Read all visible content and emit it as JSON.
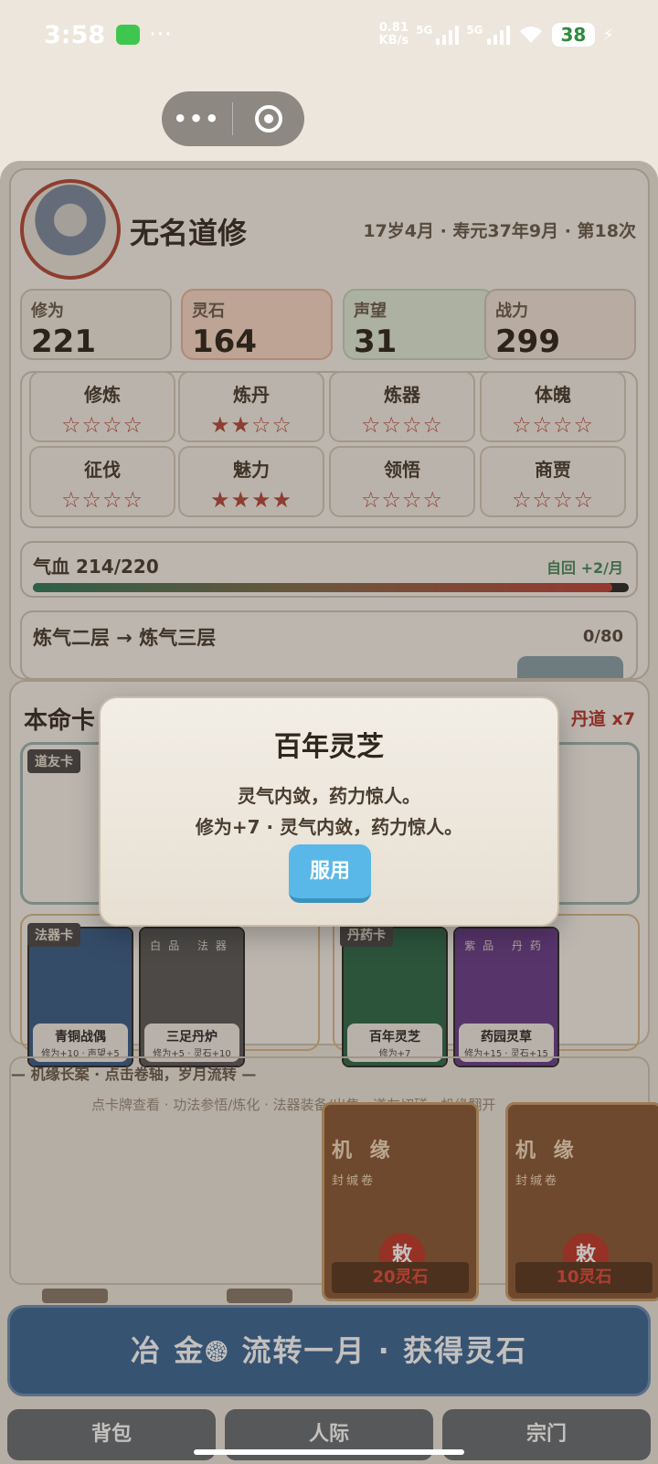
{
  "status_bar": {
    "time": "3:58",
    "dots": "···",
    "speed_top": "0.81",
    "speed_bottom": "KB/s",
    "net1": "5G",
    "net2": "5G",
    "battery": "38"
  },
  "profile": {
    "name": "无名道修",
    "meta": "17岁4月 · 寿元37年9月 · 第18次",
    "stats": [
      {
        "label": "修为",
        "value": "221"
      },
      {
        "label": "灵石",
        "value": "164"
      },
      {
        "label": "声望",
        "value": "31"
      },
      {
        "label": "战力",
        "value": "299"
      }
    ],
    "skills": [
      {
        "name": "修炼",
        "stars": "☆☆☆☆"
      },
      {
        "name": "炼丹",
        "stars": "★★☆☆"
      },
      {
        "name": "炼器",
        "stars": "☆☆☆☆"
      },
      {
        "name": "体魄",
        "stars": "☆☆☆☆"
      },
      {
        "name": "征伐",
        "stars": "☆☆☆☆"
      },
      {
        "name": "魅力",
        "stars": "★★★★"
      },
      {
        "name": "领悟",
        "stars": "☆☆☆☆"
      },
      {
        "name": "商贾",
        "stars": "☆☆☆☆"
      }
    ],
    "hp": {
      "label": "气血 214/220",
      "regen": "自回 +2/月",
      "fraction": 0.973
    },
    "realm": {
      "label": "炼气二层 → 炼气三层",
      "progress": "0/80"
    }
  },
  "fate_cards": {
    "title": "本命卡",
    "dao_badge": "丹道 x7",
    "friend_tag": "道友卡",
    "fabao_tag": "法器卡",
    "dan_tag": "丹药卡",
    "cards": [
      {
        "name": "青铜战偶",
        "effect": "修为+10 · 声望+5",
        "rarity": "",
        "color": "#3b5f8a"
      },
      {
        "name": "三足丹炉",
        "effect": "修为+5 · 灵石+10",
        "rarity": "白品 法器",
        "color": "#5a5a5a"
      },
      {
        "name": "百年灵芝",
        "effect": "修为+7",
        "rarity": "",
        "color": "#2f6a4a"
      },
      {
        "name": "药园灵草",
        "effect": "修为+15 · 灵石+15",
        "rarity": "紫品 丹药",
        "color": "#6a3f8c"
      }
    ]
  },
  "history": {
    "header": "— 机缘长案 · 点击卷轴，岁月流转 —",
    "tips": "点卡牌查看 · 功法参悟/炼化 · 法器装备/出售 · 道友切磋 · 机缘翻开",
    "chances": [
      {
        "title": "机 缘",
        "sub": "封缄卷",
        "seal": "敕",
        "price": "20灵石"
      },
      {
        "title": "机 缘",
        "sub": "封缄卷",
        "seal": "敕",
        "price": "10灵石"
      }
    ]
  },
  "main_action": "冶 金𓊗 流转一月 · 获得灵石",
  "tabs": [
    "背包",
    "人际",
    "宗门"
  ],
  "modal": {
    "title": "百年灵芝",
    "line1": "灵气内敛，药力惊人。",
    "line2": "修为+7 · 灵气内敛，药力惊人。",
    "button": "服用"
  }
}
